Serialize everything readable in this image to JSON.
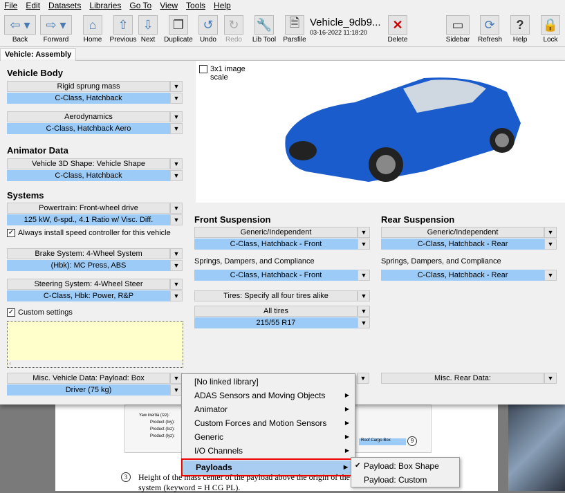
{
  "menubar": [
    "File",
    "Edit",
    "Datasets",
    "Libraries",
    "Go To",
    "View",
    "Tools",
    "Help"
  ],
  "toolbar": {
    "back": "Back",
    "forward": "Forward",
    "home": "Home",
    "previous": "Previous",
    "next": "Next",
    "duplicate": "Duplicate",
    "undo": "Undo",
    "redo": "Redo",
    "libtool": "Lib Tool",
    "parsfile": "Parsfile",
    "dataset_title": "Vehicle_9db9...",
    "dataset_date": "03-16-2022 11:18:20",
    "delete": "Delete",
    "sidebar": "Sidebar",
    "refresh": "Refresh",
    "help": "Help",
    "lock": "Lock"
  },
  "tab": "Vehicle: Assembly",
  "left": {
    "vehicle_body": "Vehicle Body",
    "rigid_label": "Rigid sprung mass",
    "rigid_value": "C-Class, Hatchback",
    "aero_label": "Aerodynamics",
    "aero_value": "C-Class, Hatchback Aero",
    "animator": "Animator Data",
    "shape_label": "Vehicle 3D Shape: Vehicle Shape",
    "shape_value": "C-Class, Hatchback",
    "systems": "Systems",
    "power_label": "Powertrain: Front-wheel drive",
    "power_value": "125 kW, 6-spd., 4.1 Ratio w/ Visc. Diff.",
    "speed_ctrl": "Always install speed controller for this vehicle",
    "brake_label": "Brake System: 4-Wheel System",
    "brake_value": "(Hbk): MC Press, ABS",
    "steer_label": "Steering System: 4-Wheel Steer",
    "steer_value": "C-Class, Hbk: Power, R&P",
    "custom": "Custom settings",
    "misc_label": "Misc. Vehicle Data: Payload: Box",
    "misc_value": "Driver (75 kg)"
  },
  "image_scale": "3x1 image scale",
  "front": {
    "title": "Front Suspension",
    "type": "Generic/Independent",
    "value": "C-Class, Hatchback - Front",
    "springs": "Springs, Dampers, and Compliance",
    "springs_value": "C-Class, Hatchback - Front",
    "tires_mode": "Tires: Specify all four tires alike",
    "tires_label": "All tires",
    "tires_value": "215/55 R17"
  },
  "rear": {
    "title": "Rear Suspension",
    "type": "Generic/Independent",
    "value": "C-Class, Hatchback - Rear",
    "springs": "Springs, Dampers, and Compliance",
    "springs_value": "C-Class, Hatchback - Rear",
    "misc": "Misc. Rear Data:"
  },
  "context_menu": [
    "[No linked library]",
    "ADAS Sensors and Moving Objects",
    "Animator",
    "Custom Forces and Motion Sensors",
    "Generic",
    "I/O Channels",
    "Payloads"
  ],
  "submenu": [
    "Payload: Box Shape",
    "Payload: Custom"
  ],
  "background_doc": {
    "line1": "Height of the mass center of the payload above the origin of the",
    "line2": "system (keyword = H CG PL).",
    "step": "3",
    "roof": "Roof Cargo Box",
    "nine": "9",
    "f1": "Yaw inertia (Izz):",
    "f2": "Product (Ixy):",
    "f3": "Product (Ixz):",
    "f4": "Product (Iyz):"
  }
}
